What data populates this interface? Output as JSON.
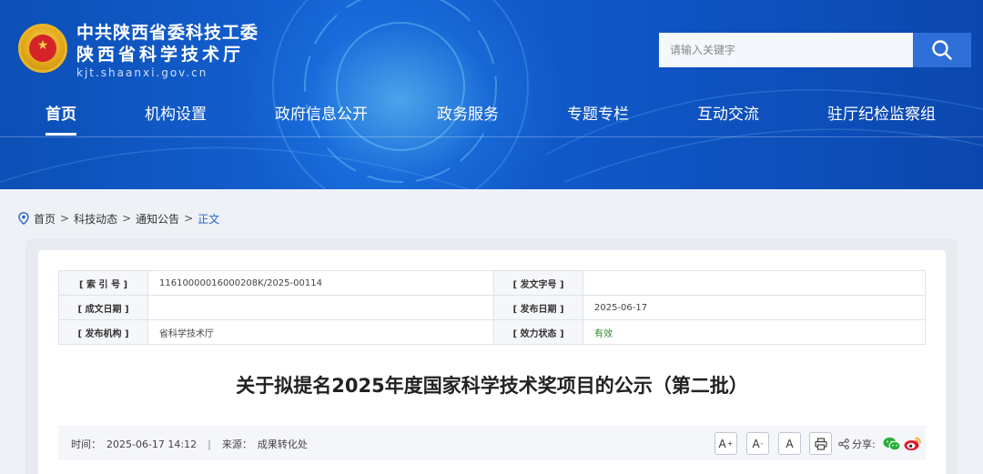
{
  "header": {
    "title_line1": "中共陕西省委科技工委",
    "title_line2": "陕西省科学技术厅",
    "domain": "kjt.shaanxi.gov.cn",
    "emblem_icon": "national-emblem-icon"
  },
  "search": {
    "placeholder": "请输入关键字",
    "value": "",
    "icon": "search-icon"
  },
  "nav": {
    "items": [
      {
        "label": "首页",
        "active": true
      },
      {
        "label": "机构设置"
      },
      {
        "label": "政府信息公开"
      },
      {
        "label": "政务服务"
      },
      {
        "label": "专题专栏"
      },
      {
        "label": "互动交流"
      },
      {
        "label": "驻厅纪检监察组"
      }
    ]
  },
  "breadcrumb": {
    "icon": "location-pin-icon",
    "items": [
      "首页",
      "科技动态",
      "通知公告",
      "正文"
    ],
    "separator": ">"
  },
  "meta": {
    "index_label": "[ 索 引 号 ]",
    "index_value": "11610000016000208K/2025-00114",
    "doc_no_label": "[ 发文字号 ]",
    "doc_no_value": "",
    "written_date_label": "[ 成文日期 ]",
    "written_date_value": "",
    "publish_date_label": "[ 发布日期 ]",
    "publish_date_value": "2025-06-17",
    "agency_label": "[ 发布机构 ]",
    "agency_value": "省科学技术厅",
    "status_label": "[ 效力状态 ]",
    "status_value": "有效"
  },
  "article": {
    "title": "关于拟提名2025年度国家科学技术奖项目的公示（第二批）",
    "time_label": "时间：",
    "time_value": "2025-06-17 14:12",
    "divider": "|",
    "source_label": "来源：",
    "source_value": "成果转化处"
  },
  "tools": {
    "font_large": "A",
    "font_medium": "A",
    "font_small": "A",
    "font_large_sup": "+",
    "font_medium_sup": "-",
    "print_icon": "printer-icon",
    "share_label": "分享:",
    "share_icon": "share-icon",
    "wechat_icon": "wechat-icon",
    "weibo_icon": "weibo-icon"
  },
  "colors": {
    "header_blue": "#1462d4",
    "accent": "#2a64c8",
    "status_green": "#2b8a2b"
  }
}
